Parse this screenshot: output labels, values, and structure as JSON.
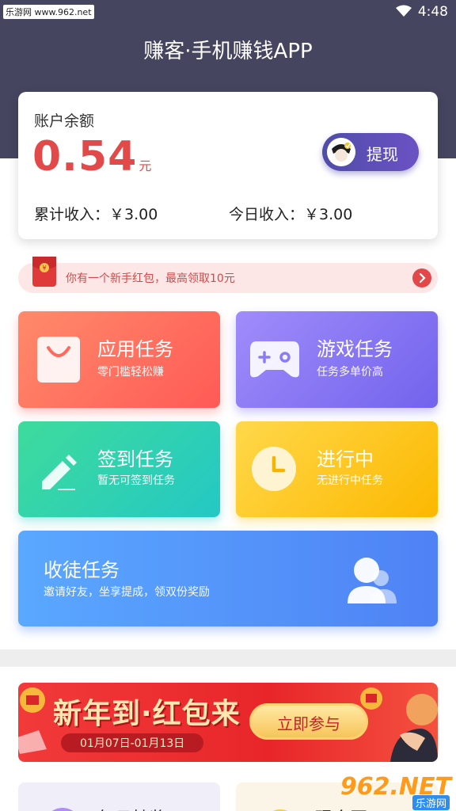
{
  "status_bar": {
    "watermark": "乐游网 www.962.net",
    "time": "4:48"
  },
  "header": {
    "title": "赚客·手机赚钱APP"
  },
  "balance": {
    "label": "账户余额",
    "amount": "0.54",
    "unit": "元",
    "withdraw_label": "提现",
    "total_income": "累计收入：￥3.00",
    "today_income": "今日收入：￥3.00"
  },
  "notice": {
    "text": "你有一个新手红包，最高领取10元"
  },
  "tasks": {
    "app": {
      "title": "应用任务",
      "subtitle": "零门槛轻松赚"
    },
    "game": {
      "title": "游戏任务",
      "subtitle": "任务多单价高"
    },
    "sign": {
      "title": "签到任务",
      "subtitle": "暂无可签到任务"
    },
    "progress": {
      "title": "进行中",
      "subtitle": "无进行中任务"
    },
    "recruit": {
      "title": "收徒任务",
      "subtitle": "邀请好友，坐享提成，领双份奖励"
    }
  },
  "banner": {
    "title": "新年到·红包来",
    "date_range": "01月07日-01月13日",
    "join_label": "立即参与"
  },
  "bottom_cards": {
    "left_title": "每日抽奖",
    "right_title": "现金区"
  },
  "watermark_bottom": {
    "number": "962.NET",
    "brand": "乐游网"
  },
  "colors": {
    "header_bg": "#46455f",
    "amount_red": "#e24a4a",
    "withdraw_purple": "#5a4fb8",
    "app_card": "#ff6a5c",
    "game_card": "#7f6ff0",
    "sign_card": "#2fd2b2",
    "progress_card": "#fdc51e",
    "recruit_card": "#5296fa",
    "banner_red": "#e8262a"
  }
}
